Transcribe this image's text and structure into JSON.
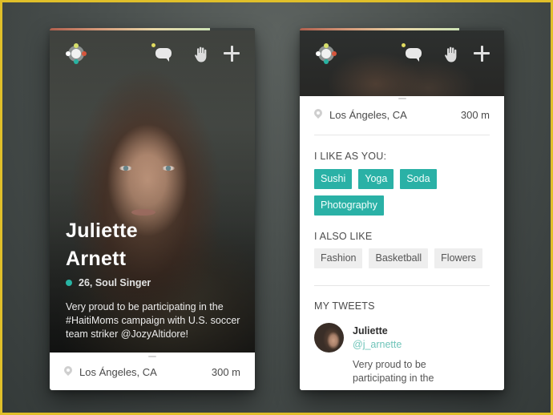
{
  "colors": {
    "accent_teal": "#2ab1a6",
    "frame_yellow": "#e0bf2a",
    "progress_gradient": [
      "#b0604e",
      "#d69a7a",
      "#e8d7a8",
      "#cde3b6"
    ]
  },
  "profile_card": {
    "progress_percent": 78,
    "toolbar": {
      "logo_icon": "app-logo-compass",
      "chat_icon": "chat-bubble-icon",
      "chat_has_notification": true,
      "hand_icon": "hand-wave-icon",
      "plus_icon": "plus-icon"
    },
    "name_first": "Juliette",
    "name_last": "Arnett",
    "status": "online",
    "age_job": "26, Soul Singer",
    "bio": "Very proud to be participating in the #HaitiMoms campaign with U.S. soccer team striker @JozyAltidore!",
    "location": "Los Ángeles, CA",
    "distance": "300 m"
  },
  "details_card": {
    "progress_percent": 78,
    "location": "Los Ángeles, CA",
    "distance": "300 m",
    "shared_likes_label": "I LIKE AS YOU:",
    "shared_likes": [
      "Sushi",
      "Yoga",
      "Soda",
      "Photography"
    ],
    "also_like_label": "I ALSO LIKE",
    "also_like": [
      "Fashion",
      "Basketball",
      "Flowers"
    ],
    "tweets_label": "MY TWEETS",
    "tweet": {
      "author": "Juliette",
      "handle": "@j_arnette",
      "text": "Very proud to be participating in the"
    }
  }
}
